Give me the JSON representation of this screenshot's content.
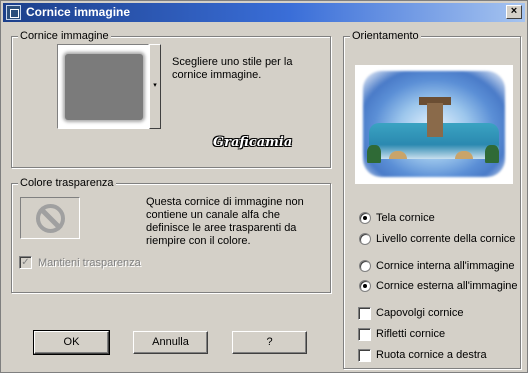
{
  "window": {
    "title": "Cornice immagine",
    "close_label": "×"
  },
  "frame_group": {
    "legend": "Cornice immagine",
    "description": "Scegliere uno stile per la cornice immagine.",
    "dropdown_arrow": "▾"
  },
  "transparency_group": {
    "legend": "Colore trasparenza",
    "info": "Questa cornice di immagine non contiene un canale alfa che definisce le aree trasparenti da riempire con il colore.",
    "keep_transparency": {
      "label": "Mantieni trasparenza",
      "checked": true,
      "enabled": false,
      "mark": "✓"
    }
  },
  "orientation_group": {
    "legend": "Orientamento",
    "target_options": [
      {
        "label": "Tela cornice",
        "selected": true
      },
      {
        "label": "Livello corrente della cornice",
        "selected": false
      }
    ],
    "placement_options": [
      {
        "label": "Cornice interna all'immagine",
        "selected": false
      },
      {
        "label": "Cornice esterna all'immagine",
        "selected": true
      }
    ],
    "checkboxes": [
      {
        "label": "Capovolgi cornice",
        "checked": false
      },
      {
        "label": "Rifletti cornice",
        "checked": false
      },
      {
        "label": "Ruota cornice a destra",
        "checked": false
      }
    ]
  },
  "buttons": {
    "ok": "OK",
    "cancel": "Annulla",
    "help": "?"
  },
  "watermark": {
    "text": "Graficamia"
  },
  "colors": {
    "titlebar_start": "#1c3f8a",
    "titlebar_end": "#a6c4f0",
    "dialog_bg": "#d4d0c8"
  }
}
